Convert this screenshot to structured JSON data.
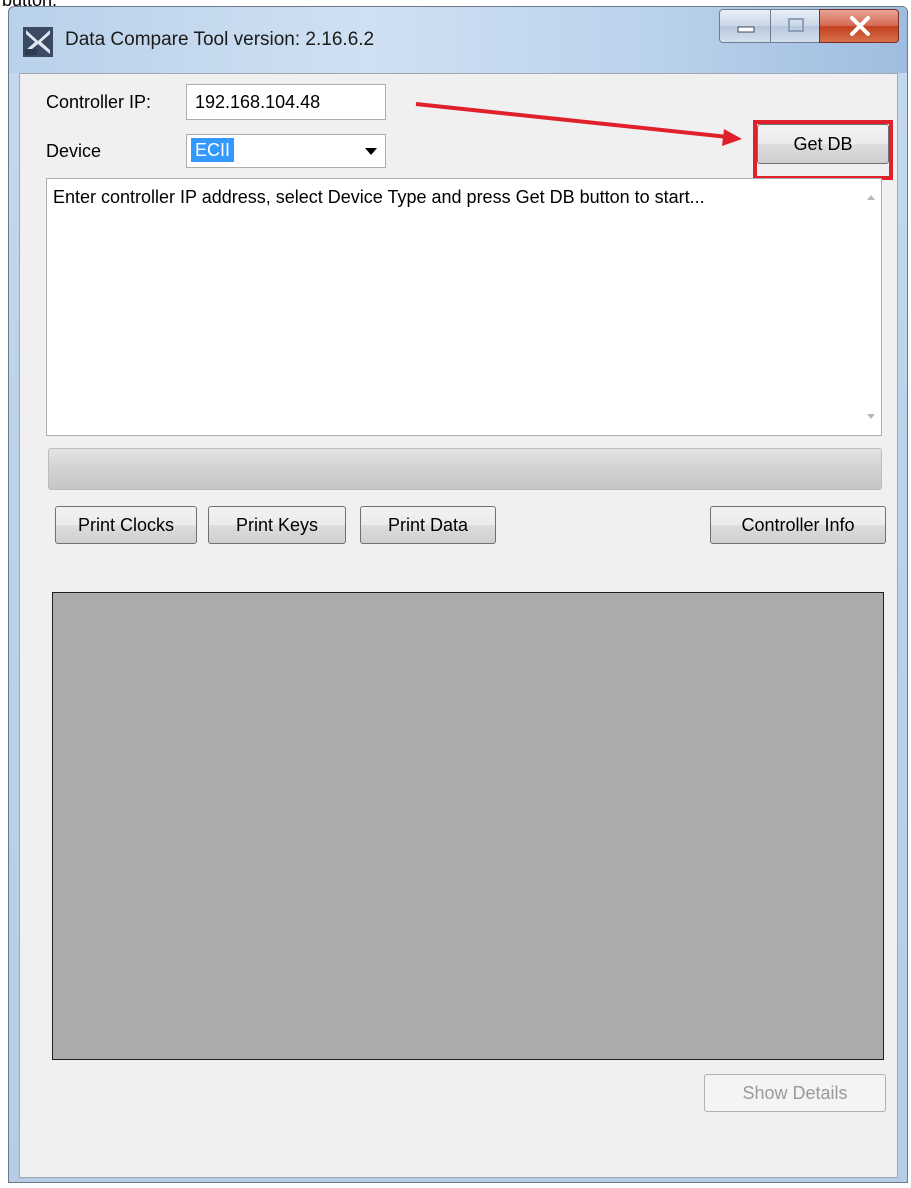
{
  "top_cut_text": "button.",
  "window": {
    "title": "Data Compare Tool version: 2.16.6.2"
  },
  "form": {
    "ip_label": "Controller IP:",
    "ip_value": "192.168.104.48",
    "device_label": "Device",
    "device_value": "ECII",
    "get_db_label": "Get DB"
  },
  "log": {
    "text": "Enter controller IP address, select Device Type and press Get DB button to start..."
  },
  "progress": {
    "value": 0
  },
  "buttons": {
    "print_clocks": "Print Clocks",
    "print_keys": "Print Keys",
    "print_data": "Print Data",
    "controller_info": "Controller Info",
    "show_details": "Show Details"
  },
  "colors": {
    "annotation": "#e0202a",
    "panel_gray": "#ababab",
    "selection": "#3399ff"
  },
  "icons": {
    "app": "app-x-logo-icon",
    "minimize": "minimize-icon",
    "maximize": "maximize-icon",
    "close": "close-icon",
    "dropdown": "chevron-down-icon"
  }
}
